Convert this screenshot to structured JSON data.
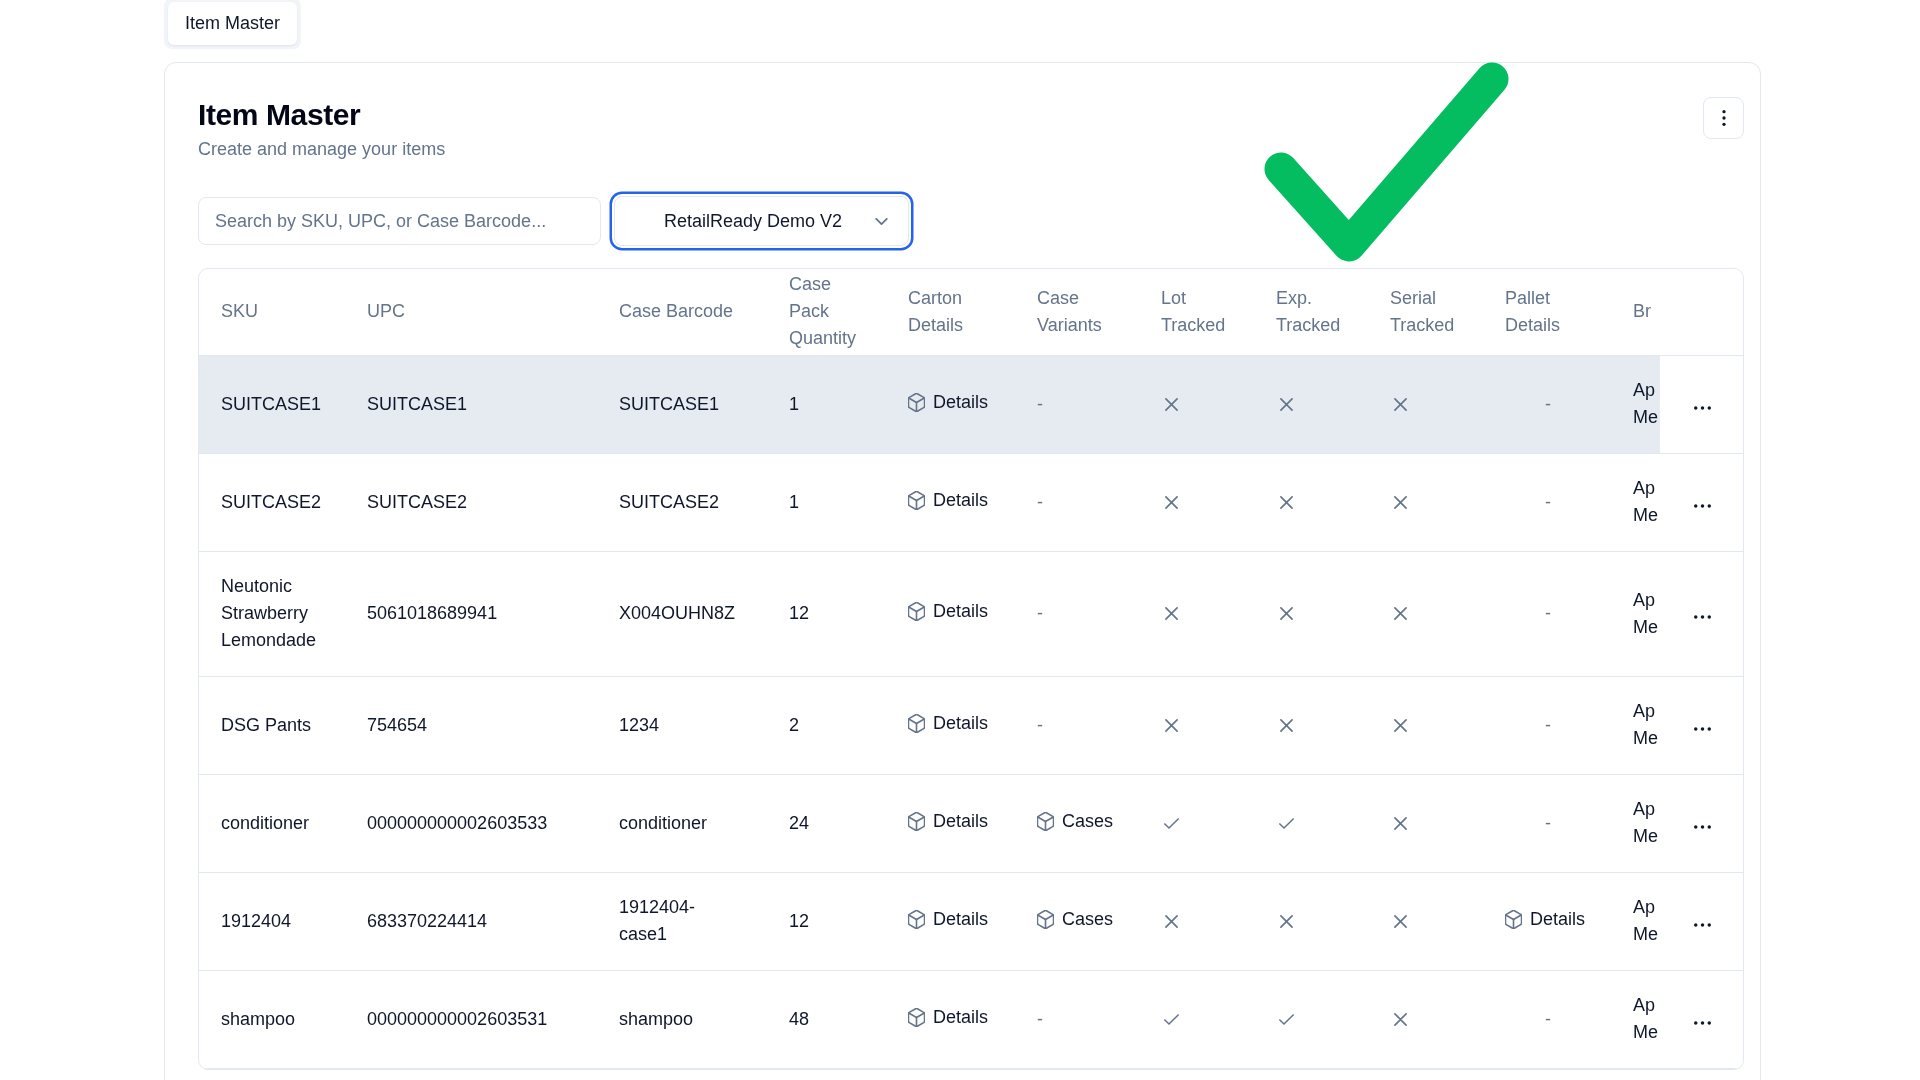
{
  "tabs": [
    {
      "label": "Item Master",
      "selected": true
    }
  ],
  "header": {
    "title": "Item Master",
    "subtitle": "Create and manage your items"
  },
  "search": {
    "placeholder": "Search by SKU, UPC, or Case Barcode..."
  },
  "account_select": {
    "value": "RetailReady Demo V2",
    "focused": true
  },
  "table": {
    "columns": [
      "SKU",
      "UPC",
      "Case Barcode",
      "Case Pack Quantity",
      "Carton Details",
      "Case Variants",
      "Lot Tracked",
      "Exp. Tracked",
      "Serial Tracked",
      "Pallet Details",
      "Br"
    ],
    "rows": [
      {
        "highlighted": true,
        "sku": "SUITCASE1",
        "upc": "SUITCASE1",
        "case_barcode": "SUITCASE1",
        "case_pack_quantity": "1",
        "carton_details": {
          "kind": "button",
          "label": "Details"
        },
        "case_variants": {
          "kind": "none",
          "label": "-"
        },
        "lot_tracked": false,
        "exp_tracked": false,
        "serial_tracked": false,
        "pallet_details": {
          "kind": "none",
          "label": "-"
        },
        "column_11": "Ap Me"
      },
      {
        "highlighted": false,
        "sku": "SUITCASE2",
        "upc": "SUITCASE2",
        "case_barcode": "SUITCASE2",
        "case_pack_quantity": "1",
        "carton_details": {
          "kind": "button",
          "label": "Details"
        },
        "case_variants": {
          "kind": "none",
          "label": "-"
        },
        "lot_tracked": false,
        "exp_tracked": false,
        "serial_tracked": false,
        "pallet_details": {
          "kind": "none",
          "label": "-"
        },
        "column_11": "Ap Me"
      },
      {
        "highlighted": false,
        "sku": "Neutonic Strawberry Lemondade",
        "upc": "5061018689941",
        "case_barcode": "X004OUHN8Z",
        "case_pack_quantity": "12",
        "carton_details": {
          "kind": "button",
          "label": "Details"
        },
        "case_variants": {
          "kind": "none",
          "label": "-"
        },
        "lot_tracked": false,
        "exp_tracked": false,
        "serial_tracked": false,
        "pallet_details": {
          "kind": "none",
          "label": "-"
        },
        "column_11": "Ap Me"
      },
      {
        "highlighted": false,
        "sku": "DSG Pants",
        "upc": "754654",
        "case_barcode": "1234",
        "case_pack_quantity": "2",
        "carton_details": {
          "kind": "button",
          "label": "Details"
        },
        "case_variants": {
          "kind": "none",
          "label": "-"
        },
        "lot_tracked": false,
        "exp_tracked": false,
        "serial_tracked": false,
        "pallet_details": {
          "kind": "none",
          "label": "-"
        },
        "column_11": "Ap Me"
      },
      {
        "highlighted": false,
        "sku": "conditioner",
        "upc": "000000000002603533",
        "case_barcode": "conditioner",
        "case_pack_quantity": "24",
        "carton_details": {
          "kind": "button",
          "label": "Details"
        },
        "case_variants": {
          "kind": "button",
          "label": "Cases"
        },
        "lot_tracked": true,
        "exp_tracked": true,
        "serial_tracked": false,
        "pallet_details": {
          "kind": "none",
          "label": "-"
        },
        "column_11": "Ap Me"
      },
      {
        "highlighted": false,
        "sku": "1912404",
        "upc": "683370224414",
        "case_barcode": "1912404-case1",
        "case_pack_quantity": "12",
        "carton_details": {
          "kind": "button",
          "label": "Details"
        },
        "case_variants": {
          "kind": "button",
          "label": "Cases"
        },
        "lot_tracked": false,
        "exp_tracked": false,
        "serial_tracked": false,
        "pallet_details": {
          "kind": "button",
          "label": "Details"
        },
        "column_11": "Ap Me"
      },
      {
        "highlighted": false,
        "sku": "shampoo",
        "upc": "000000000002603531",
        "case_barcode": "shampoo",
        "case_pack_quantity": "48",
        "carton_details": {
          "kind": "button",
          "label": "Details"
        },
        "case_variants": {
          "kind": "none",
          "label": "-"
        },
        "lot_tracked": true,
        "exp_tracked": true,
        "serial_tracked": false,
        "pallet_details": {
          "kind": "none",
          "label": "-"
        },
        "column_11": "Ap Me"
      }
    ]
  }
}
